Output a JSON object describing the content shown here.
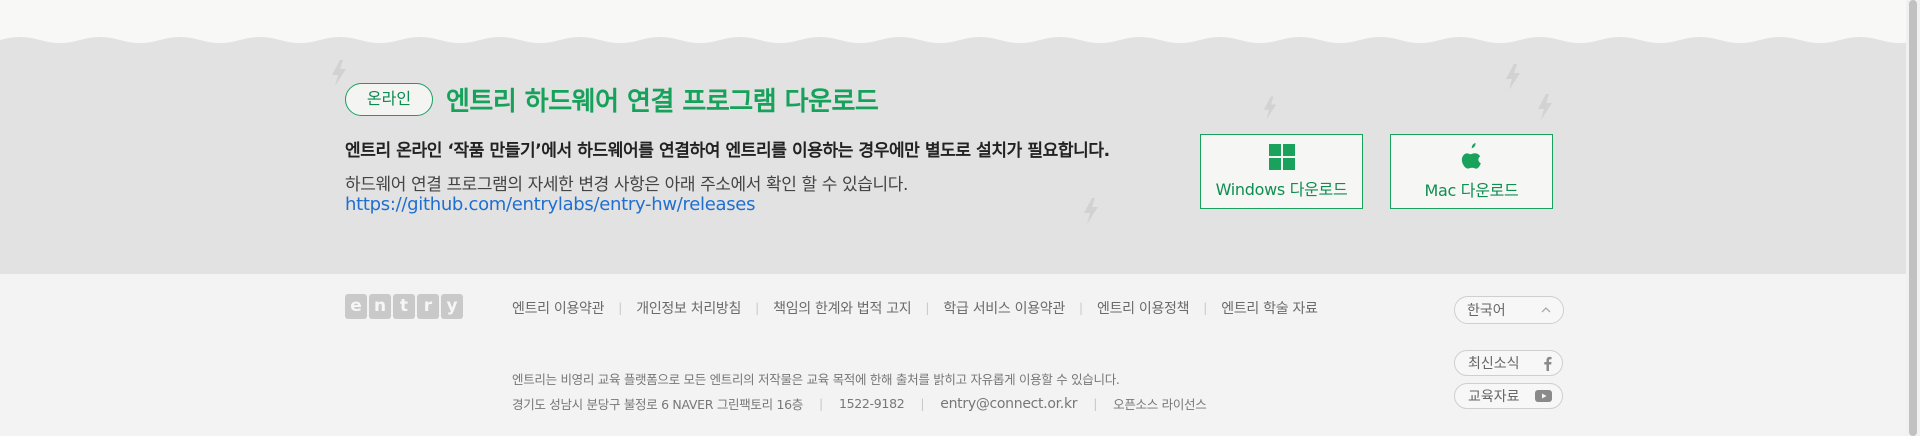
{
  "hardware": {
    "badge": "온라인",
    "title": "엔트리 하드웨어 연결 프로그램 다운로드",
    "desc_bold": "엔트리 온라인 ‘작품 만들기’에서 하드웨어를 연결하여 엔트리를 이용하는 경우에만 별도로 설치가 필요합니다.",
    "desc": "하드웨어 연결 프로그램의 자세한 변경 사항은 아래 주소에서 확인 할 수 있습니다.",
    "link": "https://github.com/entrylabs/entry-hw/releases",
    "windows_label": "Windows 다운로드",
    "mac_label": "Mac 다운로드",
    "icons": {
      "windows": "windows-icon",
      "mac": "apple-icon",
      "decoration": "lightning-bolt-icon"
    }
  },
  "footer": {
    "logo_letters": [
      "e",
      "n",
      "t",
      "r",
      "y"
    ],
    "links": [
      "엔트리 이용약관",
      "개인정보 처리방침",
      "책임의 한계와 법적 고지",
      "학급 서비스 이용약관",
      "엔트리 이용정책",
      "엔트리 학술 자료"
    ],
    "copyright": "엔트리는 비영리 교육 플랫폼으로 모든 엔트리의 저작물은 교육 목적에 한해 출처를 밝히고 자유롭게 이용할 수 있습니다.",
    "address": "경기도 성남시 분당구 불정로 6 NAVER 그린팩토리 16층",
    "phone": "1522-9182",
    "email": "entry@connect.or.kr",
    "opensource": "오픈소스 라이선스",
    "language": "한국어",
    "news": "최신소식",
    "edu": "교육자료",
    "icons": {
      "language": "chevron-up-icon",
      "news": "facebook-icon",
      "edu": "youtube-icon"
    }
  },
  "colors": {
    "accent_green": "#17a25b",
    "section_bg": "#e2e2e2",
    "footer_bg": "#f3f3f3",
    "link_blue": "#1f6fd0"
  }
}
